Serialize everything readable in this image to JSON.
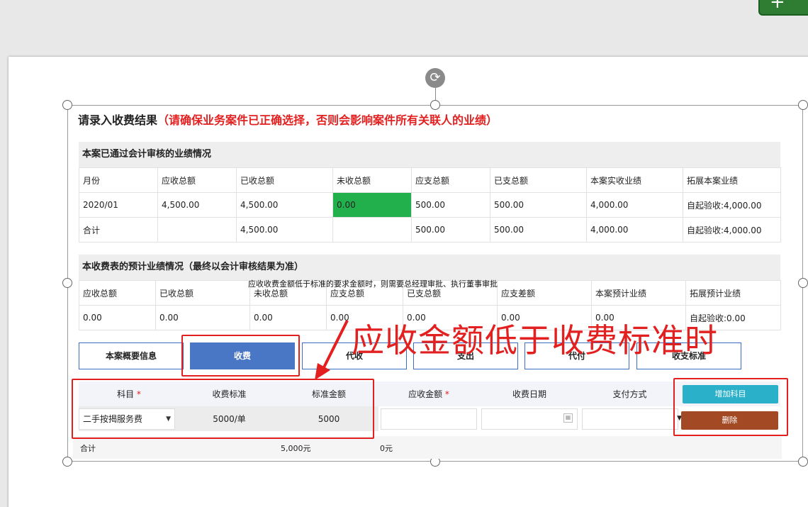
{
  "corner_button": {
    "glyph": "+"
  },
  "title": {
    "main": "请录入收费结果",
    "warning": "（请确保业务案件已正确选择，否则会影响案件所有关联人的业绩）"
  },
  "audited": {
    "heading": "本案已通过会计审核的业绩情况",
    "columns": [
      "月份",
      "应收总额",
      "已收总额",
      "未收总额",
      "应支总额",
      "已支总额",
      "本案实收业绩",
      "拓展本案业绩"
    ],
    "rows": [
      [
        "2020/01",
        "4,500.00",
        "4,500.00",
        "0.00",
        "500.00",
        "500.00",
        "4,000.00",
        "自起验收:4,000.00"
      ],
      [
        "合计",
        "",
        "4,500.00",
        "",
        "500.00",
        "500.00",
        "4,000.00",
        "自起验收:4,000.00"
      ]
    ]
  },
  "estimate": {
    "heading": "本收费表的预计业绩情况（最终以会计审核结果为准）",
    "columns": [
      "应收总额",
      "已收总额",
      "未收总额",
      "应支总额",
      "已支总额",
      "应支差额",
      "本案预计业绩",
      "拓展预计业绩"
    ],
    "row": [
      "0.00",
      "0.00",
      "0.00",
      "0.00",
      "0.00",
      "0.00",
      "0.00",
      "自起验收:0.00"
    ]
  },
  "note": "应收收费金额低于标准的要求金额时，则需要总经理审批、执行董事审批",
  "annotation": "应收金额低于收费标准时",
  "tabs": [
    "本案概要信息",
    "收费",
    "代收",
    "支出",
    "代付",
    "收支标准"
  ],
  "fee_table": {
    "headers": {
      "subject": "科目",
      "standard": "收费标准",
      "standard_amount": "标准金额",
      "receivable": "应收金额",
      "date": "收费日期",
      "payment": "支付方式"
    },
    "required_mark": "*",
    "row": {
      "subject": "二手按揭服务费",
      "standard": "5000/单",
      "standard_amount": "5000",
      "receivable": "",
      "date": "",
      "payment": ""
    }
  },
  "buttons": {
    "add": "增加科目",
    "delete": "删除"
  },
  "totals": {
    "label": "合计",
    "standard_total": "5,000元",
    "receivable_total": "0元"
  },
  "colors": {
    "accent": "#4a76c6",
    "warning": "#e32020",
    "green_cell": "#21b04c",
    "add_button": "#2bb0c9",
    "delete_button": "#a34a24"
  }
}
